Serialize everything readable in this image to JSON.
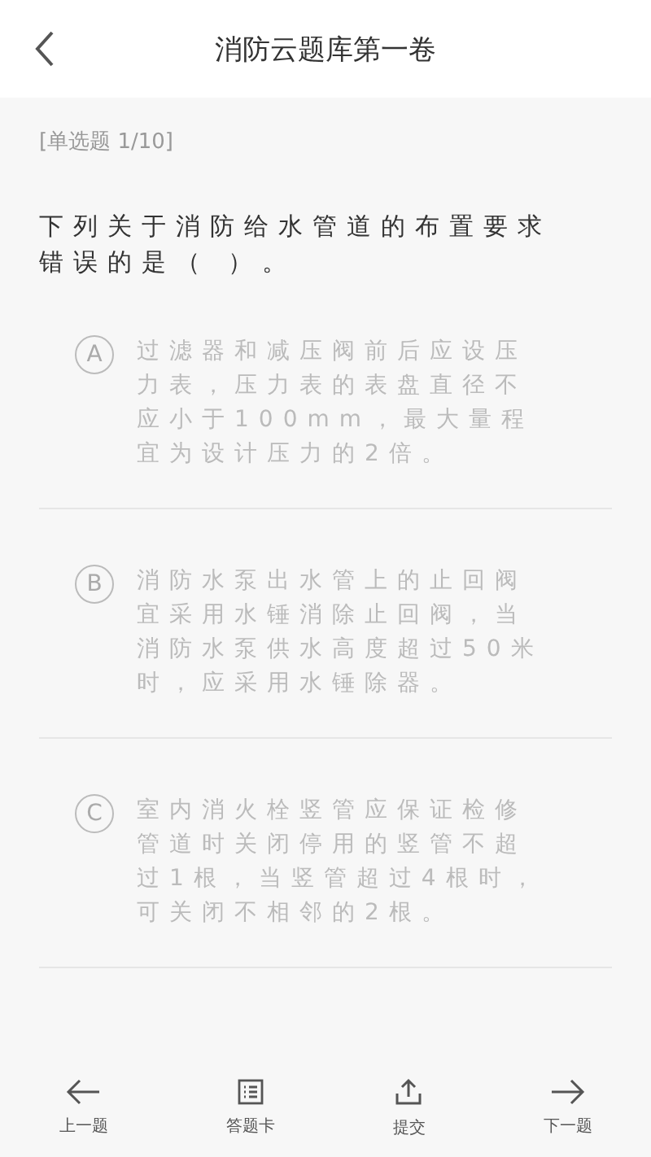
{
  "header": {
    "title": "消防云题库第一卷"
  },
  "question": {
    "type_label": "[单选题 1/10]",
    "text": "下列关于消防给水管道的布置要求错误的是（ ）。"
  },
  "options": [
    {
      "letter": "A",
      "text": "过滤器和减压阀前后应设压力表，压力表的表盘直径不应小于100mm，最大量程宜为设计压力的2倍。",
      "selected": false
    },
    {
      "letter": "B",
      "text": "消防水泵出水管上的止回阀宜采用水锤消除止回阀，当消防水泵供水高度超过50米时，应采用水锤除器。",
      "selected": false
    },
    {
      "letter": "C",
      "text": "室内消火栓竖管应保证检修管道时关闭停用的竖管不超过1根，当竖管超过4根时，可关闭不相邻的2根。",
      "selected": false
    }
  ],
  "bottom_nav": [
    {
      "kind": "prev",
      "label": "上一题"
    },
    {
      "kind": "card",
      "label": "答题卡"
    },
    {
      "kind": "submit",
      "label": "提交"
    },
    {
      "kind": "next",
      "label": "下一题"
    }
  ]
}
